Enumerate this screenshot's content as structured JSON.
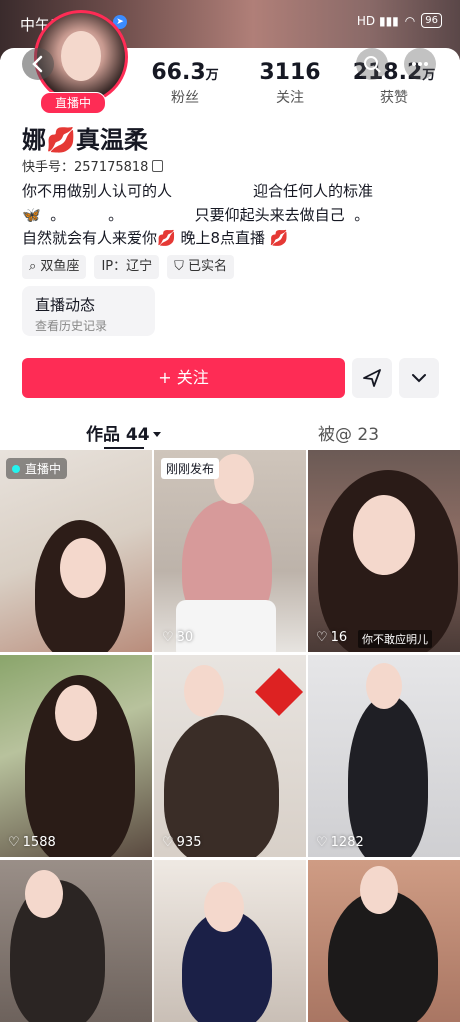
{
  "status_bar": {
    "time": "中午12:56",
    "battery": "96"
  },
  "profile": {
    "live_badge": "直播中",
    "stats": [
      {
        "num": "66.3",
        "unit": "万",
        "label": "粉丝"
      },
      {
        "num": "3116",
        "unit": "",
        "label": "关注"
      },
      {
        "num": "218.2",
        "unit": "万",
        "label": "获赞"
      }
    ],
    "name_prefix": "娜",
    "name_suffix": "真温柔",
    "kuaishou_label": "快手号：",
    "kuaishou_id": "257175818",
    "bio_line1": "你不用做别人认可的人                 迎合任何人的标准",
    "bio_line2": "  。         。               只要仰起头来去做自己  。",
    "bio_line3a": "自然就会有人来爱你",
    "bio_line3b": " 晚上8点直播 ",
    "tags": [
      "双鱼座",
      "IP：辽宁",
      "已实名"
    ],
    "dynamic_title": "直播动态",
    "dynamic_sub": "查看历史记录",
    "follow_label": "+ 关注"
  },
  "tabs": {
    "works": "作品 44",
    "tagged": "被@ 23"
  },
  "grid": [
    {
      "badge": "直播中",
      "likes": ""
    },
    {
      "badge": "刚刚发布",
      "likes": "30"
    },
    {
      "badge": "",
      "likes": "16",
      "caption": "你不敢应明儿"
    },
    {
      "badge": "",
      "likes": "1588"
    },
    {
      "badge": "",
      "likes": "935"
    },
    {
      "badge": "",
      "likes": "1282"
    },
    {
      "badge": "",
      "likes": ""
    },
    {
      "badge": "",
      "likes": ""
    },
    {
      "badge": "",
      "likes": ""
    }
  ]
}
